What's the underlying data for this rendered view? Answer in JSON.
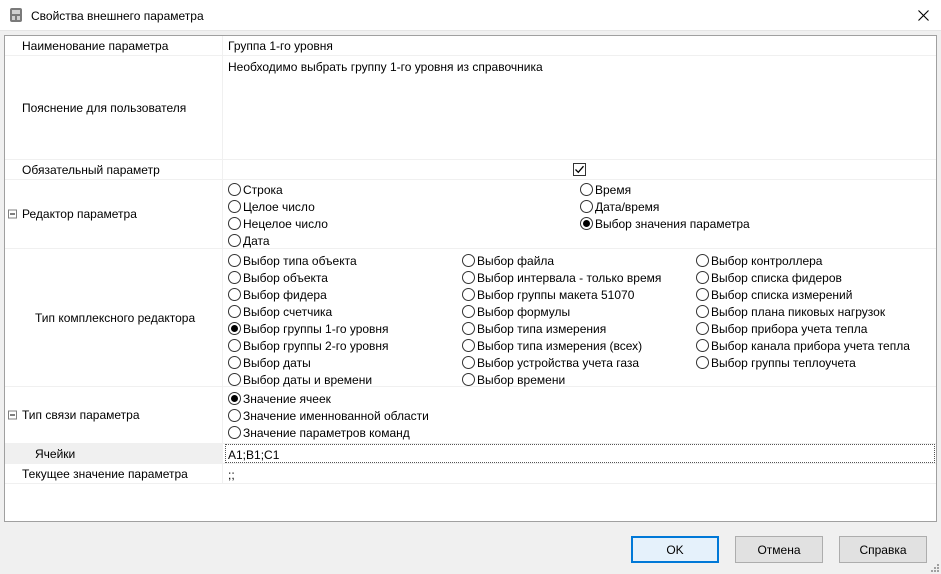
{
  "window": {
    "title": "Свойства внешнего параметра"
  },
  "rows": {
    "name": {
      "label": "Наименование параметра",
      "value": "Группа 1-го уровня"
    },
    "hint": {
      "label": "Пояснение для пользователя",
      "value": "Необходимо выбрать группу 1-го уровня из справочника"
    },
    "required": {
      "label": "Обязательный параметр",
      "checked": true
    },
    "editor": {
      "label": "Редактор параметра",
      "options_left": [
        "Строка",
        "Целое число",
        "Нецелое число",
        "Дата"
      ],
      "options_right": [
        "Время",
        "Дата/время",
        "Выбор значения параметра"
      ],
      "selected": "Выбор значения параметра"
    },
    "complex": {
      "label": "Тип комплексного редактора",
      "col1": [
        "Выбор типа объекта",
        "Выбор объекта",
        "Выбор фидера",
        "Выбор счетчика",
        "Выбор группы 1-го уровня",
        "Выбор группы 2-го уровня",
        "Выбор даты",
        "Выбор даты и времени"
      ],
      "col2": [
        "Выбор файла",
        "Выбор интервала - только время",
        "Выбор группы макета 51070",
        "Выбор формулы",
        "Выбор типа измерения",
        "Выбор типа измерения (всех)",
        "Выбор устройства учета газа",
        "Выбор времени"
      ],
      "col3": [
        "Выбор контроллера",
        "Выбор списка фидеров",
        "Выбор списка измерений",
        "Выбор плана пиковых нагрузок",
        "Выбор прибора учета тепла",
        "Выбор канала прибора учета тепла",
        "Выбор группы теплоучета"
      ],
      "selected": "Выбор группы 1-го уровня"
    },
    "link": {
      "label": "Тип связи параметра",
      "options": [
        "Значение ячеек",
        "Значение именнованной области",
        "Значение параметров команд"
      ],
      "selected": "Значение ячеек"
    },
    "cells": {
      "label": "Ячейки",
      "value": "A1;B1;C1"
    },
    "current": {
      "label": "Текущее значение параметра",
      "value": ";;"
    }
  },
  "buttons": {
    "ok": "OK",
    "cancel": "Отмена",
    "help": "Справка"
  }
}
